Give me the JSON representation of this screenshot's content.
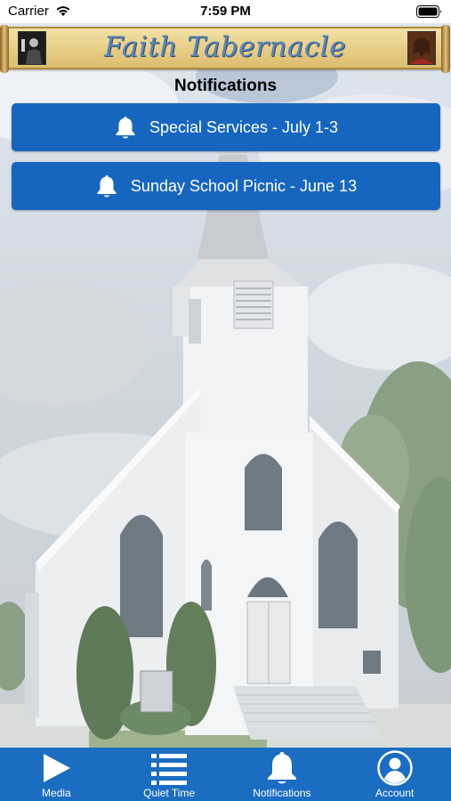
{
  "status_bar": {
    "carrier": "Carrier",
    "time": "7:59 PM"
  },
  "banner": {
    "title": "Faith Tabernacle"
  },
  "page": {
    "title": "Notifications"
  },
  "notifications": [
    {
      "label": "Special Services - July 1-3",
      "icon": "bell-icon"
    },
    {
      "label": "Sunday School Picnic - June 13",
      "icon": "bell-icon"
    }
  ],
  "tabs": [
    {
      "label": "Media",
      "icon": "play-icon"
    },
    {
      "label": "Quiet Time",
      "icon": "list-icon"
    },
    {
      "label": "Notifications",
      "icon": "bell-icon",
      "selected": true
    },
    {
      "label": "Account",
      "icon": "account-icon"
    }
  ],
  "colors": {
    "button": "#1666c0",
    "tabbar": "#1a6dc1",
    "banner_text": "#5b86b8"
  }
}
